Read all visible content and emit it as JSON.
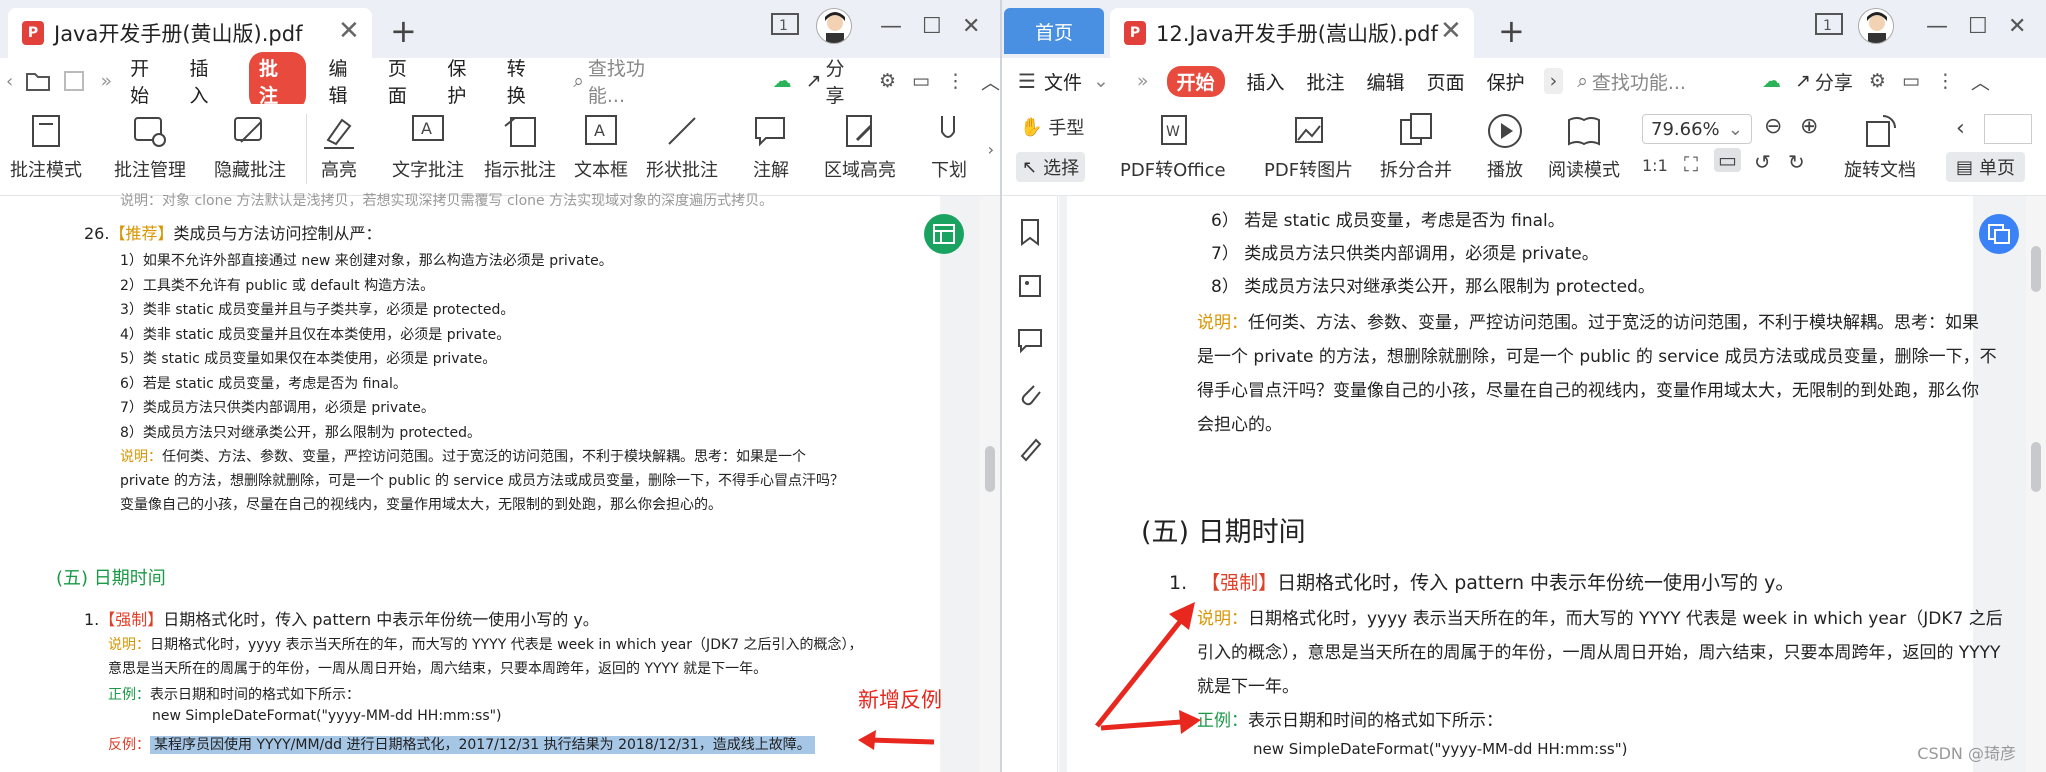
{
  "left": {
    "tab_title": "Java开发手册(黄山版).pdf",
    "menu": [
      "开始",
      "插入",
      "批注",
      "编辑",
      "页面",
      "保护",
      "转换"
    ],
    "active_menu": "批注",
    "search_placeholder": "查找功能...",
    "share_label": "分享",
    "ribbon": [
      "批注模式",
      "批注管理",
      "隐藏批注",
      "高亮",
      "文字批注",
      "指示批注",
      "文本框",
      "形状批注",
      "注解",
      "区域高亮",
      "下划"
    ],
    "doc": {
      "top_cut": "说明：对象 clone 方法默认是浅拷贝，若想实现深拷贝需覆写 clone 方法实现域对象的深度遍历式拷贝。",
      "item26_num": "26.",
      "item26_tag": "【推荐】",
      "item26_text": "类成员与方法访问控制从严：",
      "subitems": [
        "1）如果不允许外部直接通过 new 来创建对象，那么构造方法必须是 private。",
        "2）工具类不允许有 public 或 default 构造方法。",
        "3）类非 static 成员变量并且与子类共享，必须是 protected。",
        "4）类非 static 成员变量并且仅在本类使用，必须是 private。",
        "5）类 static 成员变量如果仅在本类使用，必须是 private。",
        "6）若是 static 成员变量，考虑是否为 final。",
        "7）类成员方法只供类内部调用，必须是 private。",
        "8）类成员方法只对继承类公开，那么限制为 protected。"
      ],
      "note_label": "说明：",
      "note_lines": [
        "任何类、方法、参数、变量，严控访问范围。过于宽泛的访问范围，不利于模块解耦。思考：如果是一个",
        "private 的方法，想删除就删除，可是一个 public 的 service 成员方法或成员变量，删除一下，不得手心冒点汗吗？",
        "变量像自己的小孩，尽量在自己的视线内，变量作用域太大，无限制的到处跑，那么你会担心的。"
      ],
      "section": "(五) 日期时间",
      "item1_num": "1.",
      "item1_tag": "【强制】",
      "item1_text": "日期格式化时，传入 pattern 中表示年份统一使用小写的 y。",
      "desc_label": "说明：",
      "desc_lines": [
        "日期格式化时，yyyy 表示当天所在的年，而大写的 YYYY 代表是 week in which year（JDK7 之后引入的概念），",
        "意思是当天所在的周属于的年份，一周从周日开始，周六结束，只要本周跨年，返回的 YYYY 就是下一年。"
      ],
      "example_label": "正例：",
      "example_text": "表示日期和时间的格式如下所示：",
      "code": "new SimpleDateFormat(\"yyyy-MM-dd HH:mm:ss\")",
      "counter_label": "反例：",
      "counter_text": "某程序员因使用 YYYY/MM/dd 进行日期格式化，2017/12/31 执行结果为 2018/12/31，造成线上故障。",
      "annotation": "新增反例"
    }
  },
  "right": {
    "home_tab": "首页",
    "tab_title": "12.Java开发手册(嵩山版).pdf",
    "menu": [
      "文件",
      "开始",
      "插入",
      "批注",
      "编辑",
      "页面",
      "保护"
    ],
    "active_menu": "开始",
    "search_placeholder": "查找功能...",
    "share_label": "分享",
    "ribbon": [
      "手型",
      "选择",
      "PDF转Office",
      "PDF转图片",
      "拆分合并",
      "播放",
      "阅读模式",
      "旋转文档",
      "单页"
    ],
    "zoom": "79.66%",
    "doc": {
      "subitems": [
        "6） 若是 static 成员变量，考虑是否为 final。",
        "7） 类成员方法只供类内部调用，必须是 private。",
        "8） 类成员方法只对继承类公开，那么限制为 protected。"
      ],
      "note_label": "说明：",
      "note_lines": [
        "任何类、方法、参数、变量，严控访问范围。过于宽泛的访问范围，不利于模块解耦。思考：如果",
        "是一个 private 的方法，想删除就删除，可是一个 public 的 service 成员方法或成员变量，删除一下，不",
        "得手心冒点汗吗？变量像自己的小孩，尽量在自己的视线内，变量作用域太大，无限制的到处跑，那么你",
        "会担心的。"
      ],
      "section": "(五)  日期时间",
      "item1_num": "1.",
      "item1_tag": "【强制】",
      "item1_text": "日期格式化时，传入 pattern 中表示年份统一使用小写的 y。",
      "desc_label": "说明：",
      "desc_lines": [
        "日期格式化时，yyyy 表示当天所在的年，而大写的 YYYY 代表是 week in which year（JDK7 之后",
        "引入的概念），意思是当天所在的周属于的年份，一周从周日开始，周六结束，只要本周跨年，返回的 YYYY",
        "就是下一年。"
      ],
      "example_label": "正例：",
      "example_text": "表示日期和时间的格式如下所示：",
      "code": "new SimpleDateFormat(\"yyyy-MM-dd HH:mm:ss\")"
    }
  },
  "watermark": "CSDN @琦彦",
  "colors": {
    "accent_red": "#e84a3e",
    "home_tab": "#4a90e2",
    "arrow": "#e8281e"
  }
}
